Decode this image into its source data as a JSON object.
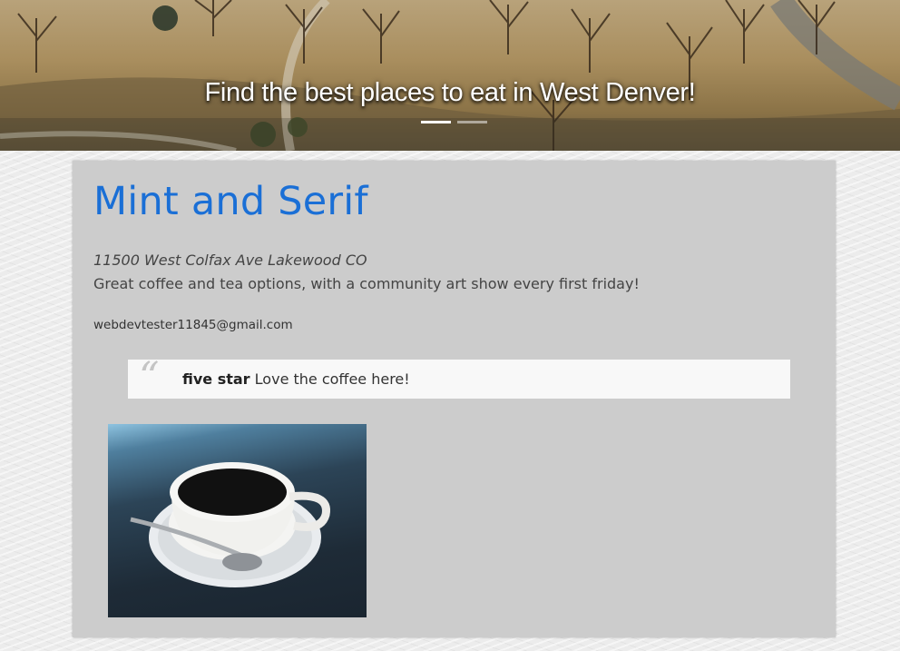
{
  "hero": {
    "caption": "Find the best places to eat in West Denver!",
    "slides_total": 2,
    "active_slide": 1
  },
  "restaurant": {
    "name": "Mint and Serif",
    "address": "11500 West Colfax Ave Lakewood CO",
    "description": "Great coffee and tea options, with a community art show every first friday!",
    "email": "webdevtester11845@gmail.com",
    "review": {
      "rating_label": "five star",
      "text": "Love the coffee here!"
    }
  },
  "colors": {
    "title": "#1a6fd6",
    "card_background": "#cccccc",
    "quote_background": "#f8f8f8"
  }
}
